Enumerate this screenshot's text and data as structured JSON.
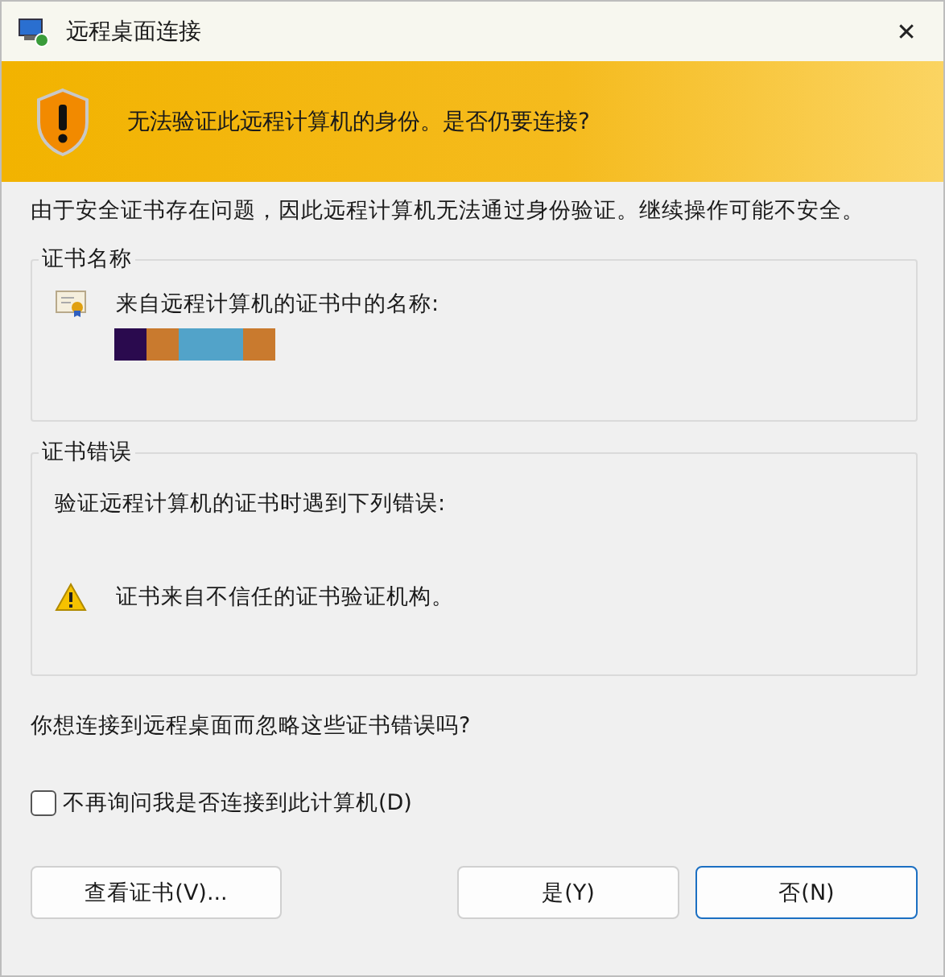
{
  "window": {
    "title": "远程桌面连接",
    "close": "✕"
  },
  "banner": {
    "text": "无法验证此远程计算机的身份。是否仍要连接?"
  },
  "intro": "由于安全证书存在问题，因此远程计算机无法通过身份验证。继续操作可能不安全。",
  "cert_name_group": {
    "legend": "证书名称",
    "label": "来自远程计算机的证书中的名称:",
    "redaction": [
      {
        "color": "#2a0a4e"
      },
      {
        "color": "#c97a2e"
      },
      {
        "color": "#52a3c9"
      },
      {
        "color": "#52a3c9"
      },
      {
        "color": "#c97a2e"
      }
    ]
  },
  "cert_error_group": {
    "legend": "证书错误",
    "label": "验证远程计算机的证书时遇到下列错误:",
    "errors": [
      "证书来自不信任的证书验证机构。"
    ]
  },
  "question": "你想连接到远程桌面而忽略这些证书错误吗?",
  "checkbox": {
    "label": "不再询问我是否连接到此计算机(D)",
    "checked": false
  },
  "buttons": [
    {
      "label": "查看证书(V)...",
      "kind": "left",
      "default": false
    },
    {
      "label": "是(Y)",
      "kind": "right",
      "default": false
    },
    {
      "label": "否(N)",
      "kind": "right",
      "default": true
    }
  ]
}
